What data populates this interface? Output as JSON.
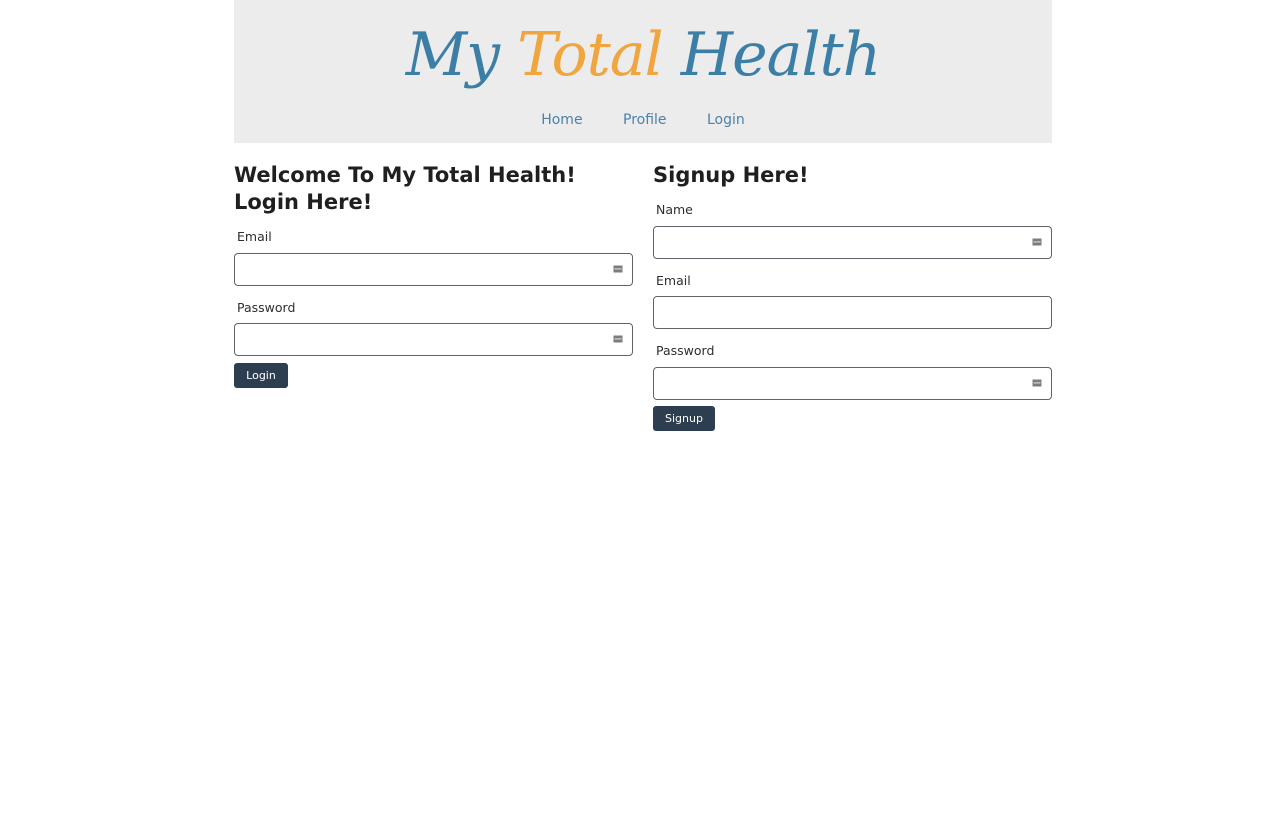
{
  "header": {
    "logo": {
      "word1": "My",
      "word2": "Total",
      "word3": "Health"
    },
    "nav": [
      "Home",
      "Profile",
      "Login"
    ]
  },
  "login": {
    "heading": "Welcome To My Total Health! Login Here!",
    "email_label": "Email",
    "password_label": "Password",
    "button_label": "Login"
  },
  "signup": {
    "heading": "Signup Here!",
    "name_label": "Name",
    "email_label": "Email",
    "password_label": "Password",
    "button_label": "Signup"
  },
  "colors": {
    "header_bg": "#ebeceb",
    "logo_blue": "#3b7ea6",
    "logo_orange": "#f0a53f",
    "nav_link": "#4b82aa",
    "button_bg": "#2e3e51"
  },
  "icons": {
    "field_autofill": "password-manager-key-icon"
  }
}
